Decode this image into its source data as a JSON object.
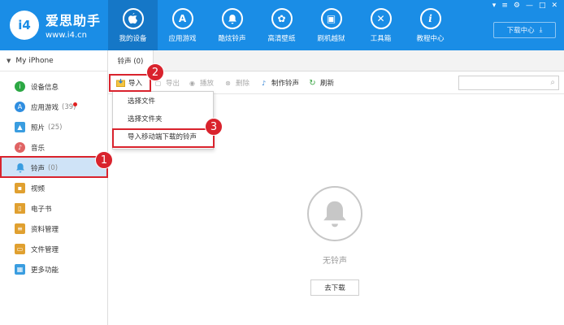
{
  "header": {
    "logo_mark": "i4",
    "app_title": "爱思助手",
    "app_url": "www.i4.cn",
    "nav": [
      {
        "label": "我的设备",
        "icon": "apple-icon",
        "glyph": "",
        "active": true
      },
      {
        "label": "应用游戏",
        "icon": "app-store-icon",
        "glyph": "A",
        "active": false
      },
      {
        "label": "酷炫铃声",
        "icon": "bell-icon",
        "glyph": "♫",
        "active": false
      },
      {
        "label": "高清壁纸",
        "icon": "flower-icon",
        "glyph": "✿",
        "active": false
      },
      {
        "label": "刷机越狱",
        "icon": "box-icon",
        "glyph": "▣",
        "active": false
      },
      {
        "label": "工具箱",
        "icon": "tools-icon",
        "glyph": "✕",
        "active": false
      },
      {
        "label": "教程中心",
        "icon": "info-icon",
        "glyph": "i",
        "active": false
      }
    ],
    "download_center": "下载中心",
    "window_controls": [
      "▾",
      "≡",
      "⚙",
      "—",
      "□",
      "✕"
    ]
  },
  "sidebar": {
    "device": "My iPhone",
    "items": [
      {
        "label": "设备信息",
        "count": "",
        "icon": "info-icon",
        "color": "#2ca844"
      },
      {
        "label": "应用游戏",
        "count": "(39)",
        "icon": "app-store-icon",
        "color": "#2f8ee0"
      },
      {
        "label": "照片",
        "count": "(25)",
        "icon": "photo-icon",
        "color": "#3a9de0"
      },
      {
        "label": "音乐",
        "count": "",
        "icon": "music-icon",
        "color": "#e06464"
      },
      {
        "label": "铃声",
        "count": "(0)",
        "icon": "bell-icon",
        "color": "#3a9de0"
      },
      {
        "label": "视频",
        "count": "",
        "icon": "video-icon",
        "color": "#e0a030"
      },
      {
        "label": "电子书",
        "count": "",
        "icon": "book-icon",
        "color": "#e0a030"
      },
      {
        "label": "资料管理",
        "count": "",
        "icon": "contacts-icon",
        "color": "#e0a030"
      },
      {
        "label": "文件管理",
        "count": "",
        "icon": "folder-icon",
        "color": "#e0a030"
      },
      {
        "label": "更多功能",
        "count": "",
        "icon": "grid-icon",
        "color": "#3a9de0"
      }
    ]
  },
  "tab": {
    "label": "铃声 (0)"
  },
  "toolbar": {
    "import": "导入",
    "export": "导出",
    "play": "播放",
    "delete": "删除",
    "make_ringtone": "制作铃声",
    "refresh": "刷新"
  },
  "dropdown": [
    "选择文件",
    "选择文件夹",
    "导入移动端下载的铃声"
  ],
  "empty": {
    "text": "无铃声",
    "button": "去下载"
  },
  "annotations": {
    "one": "1",
    "two": "2",
    "three": "3"
  },
  "colors": {
    "header": "#1a8de6",
    "active_nav": "#1577c7",
    "highlight": "#d9232d",
    "sidebar_active": "#cfe3f7"
  }
}
